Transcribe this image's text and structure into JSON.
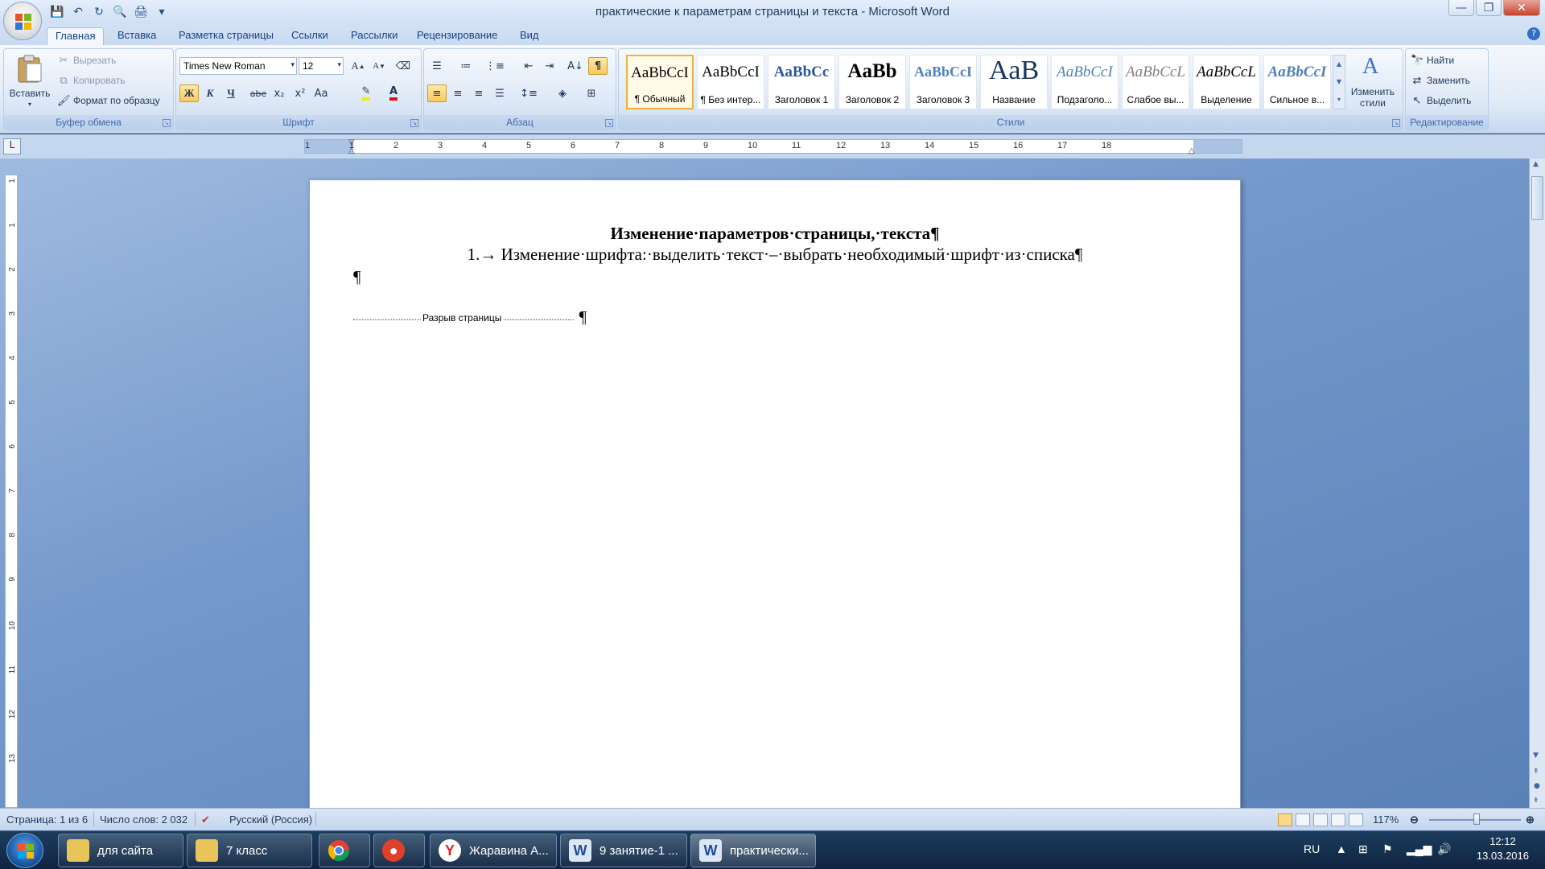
{
  "window": {
    "title": "практические к параметрам страницы и текста - Microsoft Word",
    "minimize": "—",
    "maximize": "❐",
    "close": "✕"
  },
  "qat": {
    "save_icon": "💾",
    "undo_icon": "↶",
    "redo_icon": "↻",
    "preview_icon": "🔍",
    "print_icon": "🖨",
    "customize_icon": "▾"
  },
  "tabs": [
    {
      "label": "Главная",
      "active": true
    },
    {
      "label": "Вставка"
    },
    {
      "label": "Разметка страницы"
    },
    {
      "label": "Ссылки"
    },
    {
      "label": "Рассылки"
    },
    {
      "label": "Рецензирование"
    },
    {
      "label": "Вид"
    }
  ],
  "help": "?",
  "clipboard": {
    "label": "Буфер обмена",
    "paste": "Вставить",
    "cut": "Вырезать",
    "copy": "Копировать",
    "format_painter": "Формат по образцу"
  },
  "font": {
    "label": "Шрифт",
    "name": "Times New Roman",
    "size": "12",
    "bold": "Ж",
    "italic": "К",
    "underline": "Ч",
    "strike": "abe",
    "subscript": "x₂",
    "superscript": "x²",
    "case": "Aa",
    "grow": "A",
    "shrink": "A",
    "clear": "⌫"
  },
  "paragraph": {
    "label": "Абзац",
    "show_marks": "¶"
  },
  "styles": {
    "label": "Стили",
    "items": [
      {
        "preview": "AaBbCcI",
        "name": "¶ Обычный",
        "selected": true
      },
      {
        "preview": "AaBbCcI",
        "name": "¶ Без интер..."
      },
      {
        "preview": "AaBbCc",
        "name": "Заголовок 1"
      },
      {
        "preview": "AaBb",
        "name": "Заголовок 2"
      },
      {
        "preview": "AaBbCcI",
        "name": "Заголовок 3"
      },
      {
        "preview": "AaB",
        "name": "Название"
      },
      {
        "preview": "AaBbCcI",
        "name": "Подзаголо..."
      },
      {
        "preview": "AaBbCcL",
        "name": "Слабое вы..."
      },
      {
        "preview": "AaBbCcL",
        "name": "Выделение"
      },
      {
        "preview": "AaBbCcI",
        "name": "Сильное в..."
      }
    ],
    "change_styles": "Изменить стили"
  },
  "editing": {
    "label": "Редактирование",
    "find": "Найти",
    "replace": "Заменить",
    "select": "Выделить"
  },
  "ruler": {
    "corner": "L",
    "h_numbers": [
      "1",
      "1",
      "2",
      "3",
      "4",
      "5",
      "6",
      "7",
      "8",
      "9",
      "10",
      "11",
      "12",
      "13",
      "14",
      "15",
      "16",
      "17",
      "18"
    ],
    "v_numbers": [
      "1",
      "1",
      "2",
      "3",
      "4",
      "5",
      "6",
      "7",
      "8",
      "9",
      "10",
      "11",
      "12",
      "13"
    ]
  },
  "document": {
    "title": "Изменение·параметров·страницы,·текста¶",
    "item": "1.→ Изменение·шрифта:·выделить·текст·–·выбрать·необходимый·шрифт·из·списка¶",
    "empty_para": "¶",
    "page_break_label": "Разрыв страницы",
    "page_break_mark": "¶"
  },
  "status": {
    "page": "Страница: 1 из 6",
    "words": "Число слов: 2 032",
    "language": "Русский (Россия)",
    "zoom": "117%",
    "zoom_level_percent": 117
  },
  "taskbar": {
    "items": [
      {
        "label": "для сайта",
        "icon": "📁"
      },
      {
        "label": "7 класс",
        "icon": "📁"
      },
      {
        "label": "",
        "icon": "chrome"
      },
      {
        "label": "",
        "icon": "app"
      },
      {
        "label": "Жаравина А...",
        "icon": "Y"
      },
      {
        "label": "9 занятие-1 ...",
        "icon": "W"
      },
      {
        "label": "практически...",
        "icon": "W"
      }
    ],
    "lang": "RU",
    "time": "12:12",
    "date": "13.03.2016"
  }
}
